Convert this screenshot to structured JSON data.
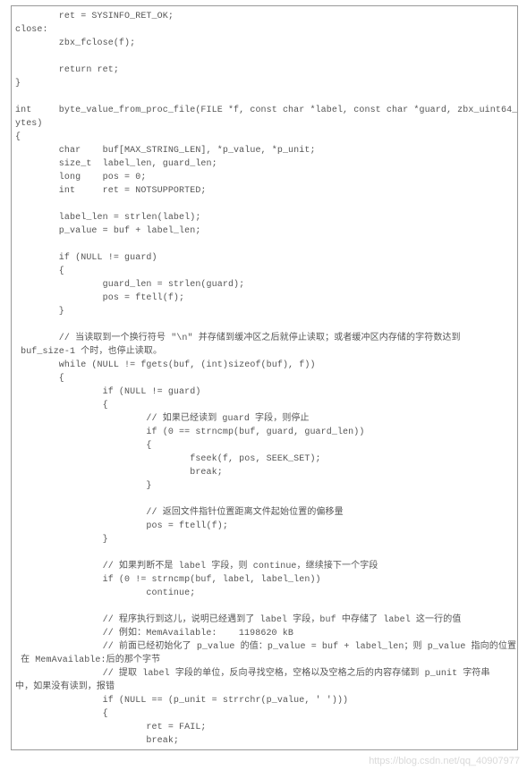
{
  "code": {
    "lines": [
      "        ret = SYSINFO_RET_OK;",
      "close:",
      "        zbx_fclose(f);",
      "",
      "        return ret;",
      "}",
      "",
      "int     byte_value_from_proc_file(FILE *f, const char *label, const char *guard, zbx_uint64_t *b",
      "ytes)",
      "{",
      "        char    buf[MAX_STRING_LEN], *p_value, *p_unit;",
      "        size_t  label_len, guard_len;",
      "        long    pos = 0;",
      "        int     ret = NOTSUPPORTED;",
      "",
      "        label_len = strlen(label);",
      "        p_value = buf + label_len;",
      "",
      "        if (NULL != guard)",
      "        {",
      "                guard_len = strlen(guard);",
      "                pos = ftell(f);",
      "        }",
      "",
      "        // 当读取到一个换行符号 \"\\n\" 并存储到缓冲区之后就停止读取；或者缓冲区内存储的字符数达到",
      " buf_size-1 个时，也停止读取。",
      "        while (NULL != fgets(buf, (int)sizeof(buf), f))",
      "        {",
      "                if (NULL != guard)",
      "                {",
      "                        // 如果已经读到 guard 字段，则停止",
      "                        if (0 == strncmp(buf, guard, guard_len))",
      "                        {",
      "                                fseek(f, pos, SEEK_SET);",
      "                                break;",
      "                        }",
      "",
      "                        // 返回文件指针位置距离文件起始位置的偏移量",
      "                        pos = ftell(f);",
      "                }",
      "",
      "                // 如果判断不是 label 字段，则 continue，继续接下一个字段",
      "                if (0 != strncmp(buf, label, label_len))",
      "                        continue;",
      "",
      "                // 程序执行到这儿，说明已经遇到了 label 字段，buf 中存储了 label 这一行的值",
      "                // 例如：MemAvailable:    1198620 kB",
      "                // 前面已经初始化了 p_value 的值：p_value = buf + label_len；则 p_value 指向的位置",
      " 在 MemAvailable:后的那个字节",
      "                // 提取 label 字段的单位，反向寻找空格，空格以及空格之后的内容存储到 p_unit 字符串",
      "中，如果没有读到，报错",
      "                if (NULL == (p_unit = strrchr(p_value, ' ')))",
      "                {",
      "                        ret = FAIL;",
      "                        break;"
    ]
  },
  "watermark": "https://blog.csdn.net/qq_40907977"
}
